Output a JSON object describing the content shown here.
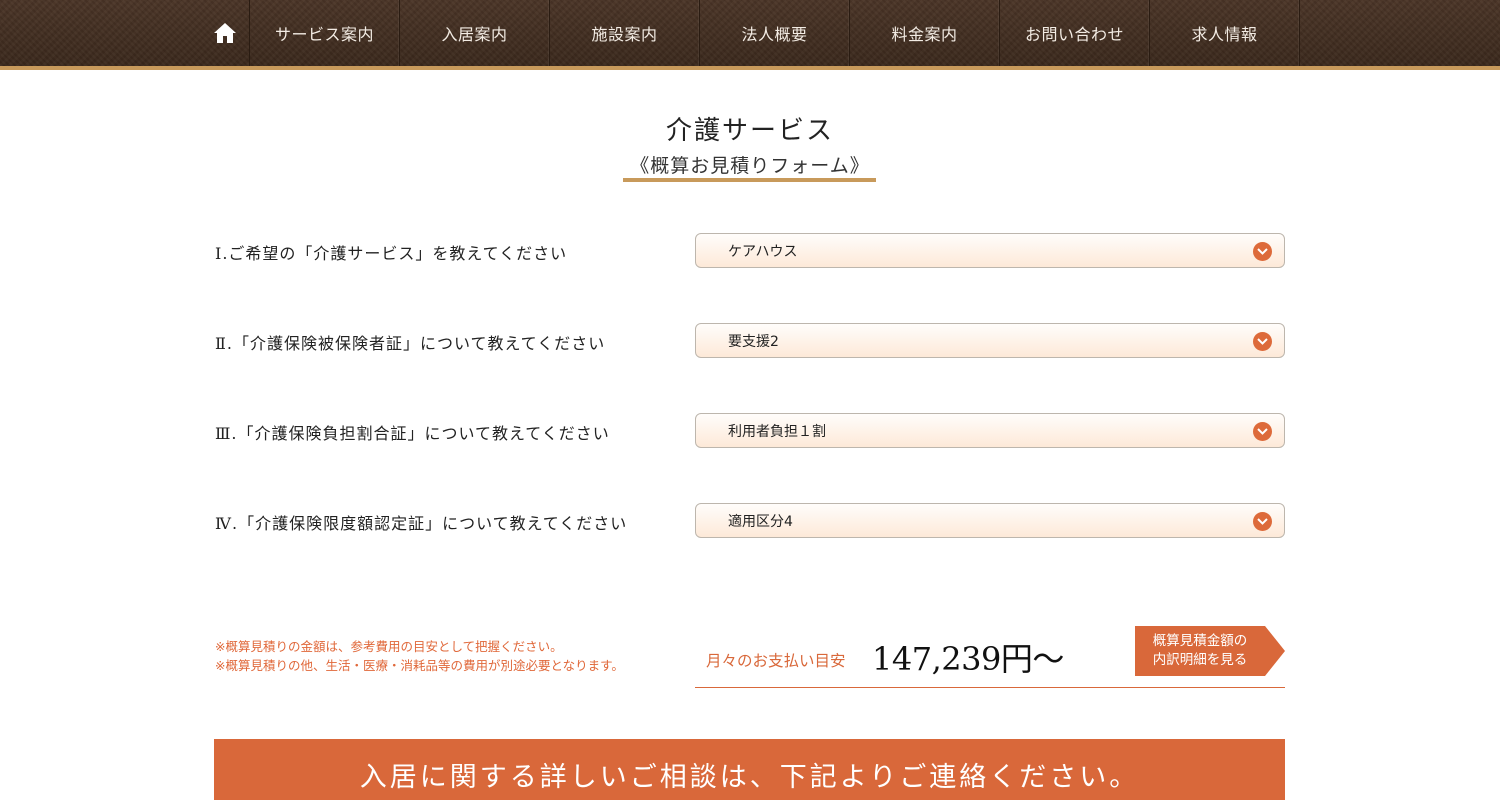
{
  "nav": {
    "home_icon": "home-icon",
    "items": [
      "サービス案内",
      "入居案内",
      "施設案内",
      "法人概要",
      "料金案内",
      "お問い合わせ",
      "求人情報"
    ]
  },
  "title": {
    "main": "介護サービス",
    "sub": "《概算お見積りフォーム》"
  },
  "questions": [
    {
      "label": "Ⅰ.ご希望の「介護サービス」を教えてください",
      "value": "ケアハウス"
    },
    {
      "label": "Ⅱ.「介護保険被保険者証」について教えてください",
      "value": "要支援2"
    },
    {
      "label": "Ⅲ.「介護保険負担割合証」について教えてください",
      "value": "利用者負担１割"
    },
    {
      "label": "Ⅳ.「介護保険限度額認定証」について教えてください",
      "value": "適用区分4"
    }
  ],
  "notes": [
    "※概算見積りの金額は、参考費用の目安として把握ください。",
    "※概算見積りの他、生活・医療・消耗品等の費用が別途必要となります。"
  ],
  "payment": {
    "label": "月々のお支払い目安",
    "amount": "147,239円～"
  },
  "breakdown_button": {
    "line1": "概算見積金額の",
    "line2": "内訳明細を見る"
  },
  "banner": {
    "text": "入居に関する詳しいご相談は、下記よりご連絡ください。"
  },
  "colors": {
    "accent": "#d9683a",
    "gold": "#c89a5b",
    "nav_bg": "#3e2a1e"
  }
}
